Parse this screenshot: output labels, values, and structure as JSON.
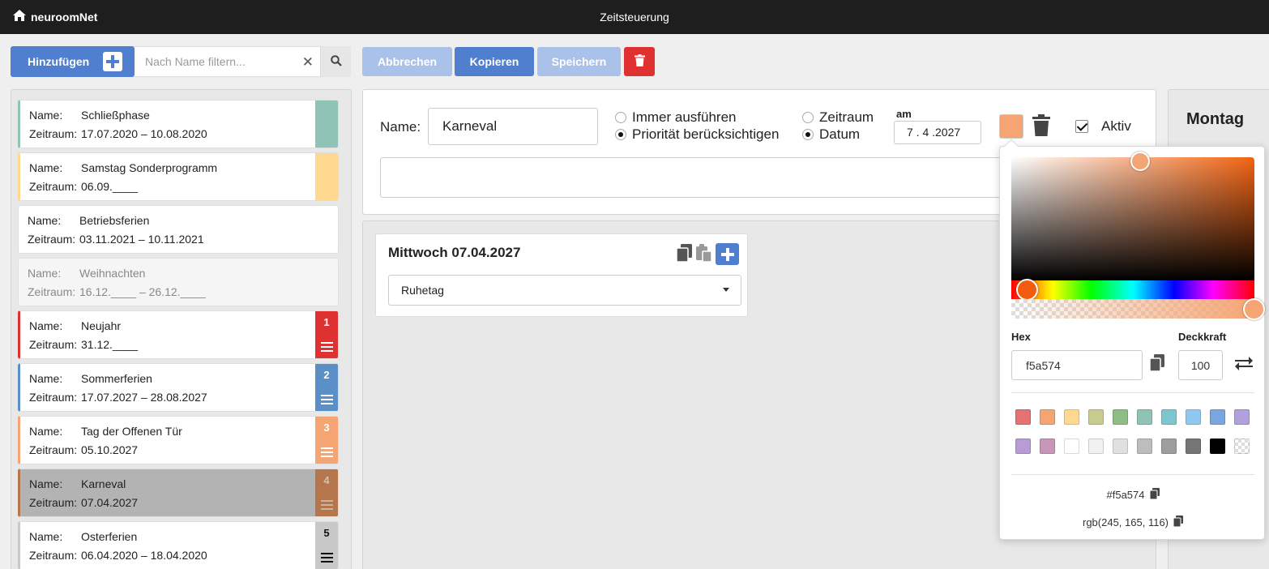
{
  "app": {
    "brand": "neuroomNet",
    "title": "Zeitsteuerung"
  },
  "toolbar": {
    "add_label": "Hinzufügen",
    "filter_placeholder": "Nach Name filtern...",
    "cancel_label": "Abbrechen",
    "copy_label": "Kopieren",
    "save_label": "Speichern"
  },
  "list": {
    "name_label": "Name:",
    "period_label": "Zeitraum:",
    "items": [
      {
        "name": "Schließphase",
        "period": "17.07.2020 – 10.08.2020",
        "color": "#8ec3b5",
        "number": "",
        "state": "normal"
      },
      {
        "name": "Samstag Sonderprogramm",
        "period": "06.09.____",
        "color": "#fdd88e",
        "number": "",
        "state": "normal"
      },
      {
        "name": "Betriebsferien",
        "period": "03.11.2021 – 10.11.2021",
        "color": "",
        "number": "",
        "state": "normal"
      },
      {
        "name": "Weihnachten",
        "period": "16.12.____ – 26.12.____",
        "color": "",
        "number": "",
        "state": "muted"
      },
      {
        "name": "Neujahr",
        "period": "31.12.____",
        "color": "#e03131",
        "number": "1",
        "state": "normal"
      },
      {
        "name": "Sommerferien",
        "period": "17.07.2027 – 28.08.2027",
        "color": "#5b8fc7",
        "number": "2",
        "state": "normal"
      },
      {
        "name": "Tag der Offenen Tür",
        "period": "05.10.2027",
        "color": "#f5a574",
        "number": "3",
        "state": "normal"
      },
      {
        "name": "Karneval",
        "period": "07.04.2027",
        "color": "#b5764c",
        "number": "4",
        "state": "selected"
      },
      {
        "name": "Osterferien",
        "period": "06.04.2020 – 18.04.2020",
        "color": "#c8c8c8",
        "number": "5",
        "state": "normal"
      }
    ]
  },
  "editor": {
    "name_label": "Name:",
    "name_value": "Karneval",
    "radio_always": "Immer ausführen",
    "radio_priority": "Priorität berücksichtigen",
    "radio_period": "Zeitraum",
    "radio_date": "Datum",
    "am_label": "am",
    "date_value": "7 . 4 .2027",
    "color": "#f5a574",
    "active_label": "Aktiv"
  },
  "day": {
    "title": "Mittwoch 07.04.2027",
    "select_value": "Ruhetag"
  },
  "right": {
    "day_label": "Montag"
  },
  "picker": {
    "hex_label": "Hex",
    "opacity_label": "Deckkraft",
    "hex_value": "f5a574",
    "opacity_value": "100",
    "hex_output": "#f5a574",
    "rgb_output": "rgb(245, 165, 116)",
    "palette_row1": [
      "#e57373",
      "#f5a574",
      "#fdd88e",
      "#c5cc8e",
      "#8fbd87",
      "#8ec3b5",
      "#7dc6cf",
      "#8ec8f0",
      "#7aa6e0",
      "#b1a0dc"
    ],
    "palette_row2": [
      "#b99cd6",
      "#c796b8",
      "#ffffff",
      "#f0f0f0",
      "#e0e0e0",
      "#bdbdbd",
      "#9e9e9e",
      "#757575",
      "#000000",
      "transparent"
    ]
  }
}
